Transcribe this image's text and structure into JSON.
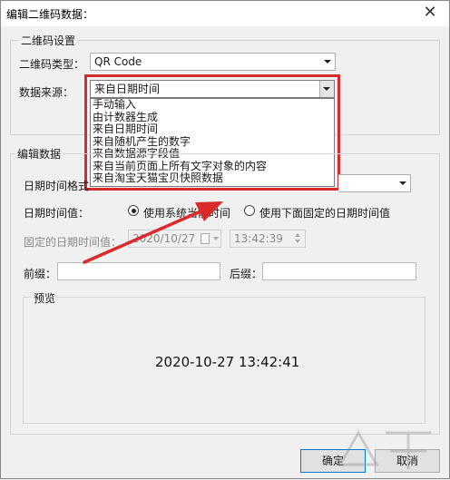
{
  "window": {
    "title": "编辑二维码数据：",
    "close_glyph": "✕"
  },
  "qr_settings": {
    "group_title": "二维码设置",
    "type_label": "二维码类型：",
    "type_value": "QR Code",
    "source_label": "数据来源：",
    "source_value": "来自日期时间",
    "source_options": [
      "手动输入",
      "由计数器生成",
      "来自日期时间",
      "来自随机产生的数字",
      "来自数据源字段值",
      "来自当前页面上所有文字对象的内容",
      "来自淘宝天猫宝贝快照数据"
    ]
  },
  "edit_data": {
    "group_title": "编辑数据",
    "format_label": "日期时间格式",
    "value_label": "日期时间值：",
    "radio_system": "使用系统当前时间",
    "radio_fixed": "使用下面固定的日期时间值",
    "fixed_label": "固定的日期时间值：",
    "fixed_date": "2020/10/27",
    "fixed_time": "13:42:39",
    "prefix_label": "前缀：",
    "suffix_label": "后缀：",
    "prefix_value": "",
    "suffix_value": ""
  },
  "preview": {
    "label": "预览",
    "text": "2020-10-27 13:42:41"
  },
  "buttons": {
    "ok": "确定",
    "cancel": "取消"
  },
  "colors": {
    "highlight": "#d92b2b",
    "default_button_border": "#0078d7"
  }
}
